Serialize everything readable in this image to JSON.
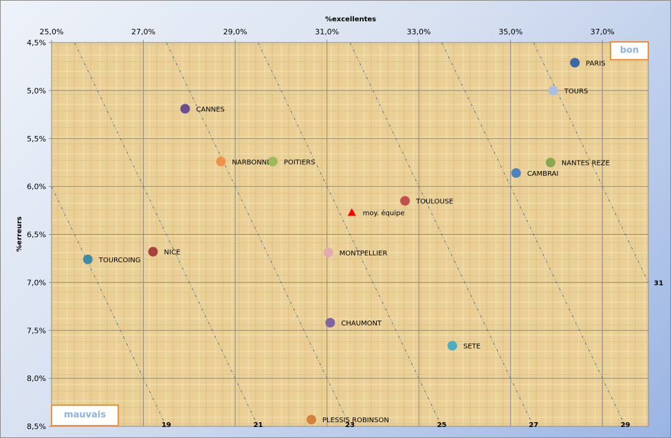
{
  "chart_data": {
    "type": "scatter",
    "xlabel": "%excellentes",
    "ylabel": "%erreurs",
    "xlim": [
      25,
      38
    ],
    "ylim": [
      4.5,
      8.5
    ],
    "y_reversed": true,
    "x_axis_position": "top",
    "x_ticks": [
      "25,0%",
      "27,0%",
      "29,0%",
      "31,0%",
      "33,0%",
      "35,0%",
      "37,0%"
    ],
    "x_tick_values": [
      25,
      27,
      29,
      31,
      33,
      35,
      37
    ],
    "y_ticks": [
      "4,5%",
      "5,0%",
      "5,5%",
      "6,0%",
      "6,5%",
      "7,0%",
      "7,5%",
      "8,0%",
      "8,5%"
    ],
    "y_tick_values": [
      4.5,
      5,
      5.5,
      6,
      6.5,
      7,
      7.5,
      8,
      8.5
    ],
    "grid": true,
    "points": [
      {
        "name": "PARIS",
        "x": 36.4,
        "y": 4.71,
        "color": "#3f68a6",
        "marker": "circle"
      },
      {
        "name": "TOURS",
        "x": 35.93,
        "y": 5.0,
        "color": "#a9bfe2",
        "marker": "circle"
      },
      {
        "name": "CANNES",
        "x": 27.91,
        "y": 5.19,
        "color": "#6b4f8c",
        "marker": "circle"
      },
      {
        "name": "NARBONNE",
        "x": 28.69,
        "y": 5.74,
        "color": "#f0914a",
        "marker": "circle"
      },
      {
        "name": "POITIERS",
        "x": 29.82,
        "y": 5.74,
        "color": "#9bbb59",
        "marker": "circle"
      },
      {
        "name": "NANTES REZE",
        "x": 35.87,
        "y": 5.75,
        "color": "#8aa84f",
        "marker": "circle"
      },
      {
        "name": "CAMBRAI",
        "x": 35.12,
        "y": 5.86,
        "color": "#4f81bd",
        "marker": "circle"
      },
      {
        "name": "TOULOUSE",
        "x": 32.7,
        "y": 6.15,
        "color": "#c0504d",
        "marker": "circle"
      },
      {
        "name": "moy. équipe",
        "x": 31.54,
        "y": 6.27,
        "color": "#ff0000",
        "marker": "triangle"
      },
      {
        "name": "NICE",
        "x": 27.21,
        "y": 6.68,
        "color": "#a8403d",
        "marker": "circle"
      },
      {
        "name": "MONTPELLIER",
        "x": 31.03,
        "y": 6.69,
        "color": "#e2aab2",
        "marker": "circle"
      },
      {
        "name": "TOURCOING",
        "x": 25.79,
        "y": 6.76,
        "color": "#3a8ea6",
        "marker": "circle"
      },
      {
        "name": "CHAUMONT",
        "x": 31.07,
        "y": 7.42,
        "color": "#8064a2",
        "marker": "circle"
      },
      {
        "name": "SETE",
        "x": 33.73,
        "y": 7.66,
        "color": "#4bacc6",
        "marker": "circle"
      },
      {
        "name": "PLESSIS ROBINSON",
        "x": 30.66,
        "y": 8.43,
        "color": "#d4823e",
        "marker": "circle"
      }
    ],
    "iso_lines": [
      {
        "label": "19",
        "value": 19
      },
      {
        "label": "21",
        "value": 21
      },
      {
        "label": "23",
        "value": 23
      },
      {
        "label": "25",
        "value": 25
      },
      {
        "label": "27",
        "value": 27
      },
      {
        "label": "29",
        "value": 29
      },
      {
        "label": "31",
        "value": 31
      }
    ],
    "annotations": {
      "good": "bon",
      "bad": "mauvais"
    }
  }
}
